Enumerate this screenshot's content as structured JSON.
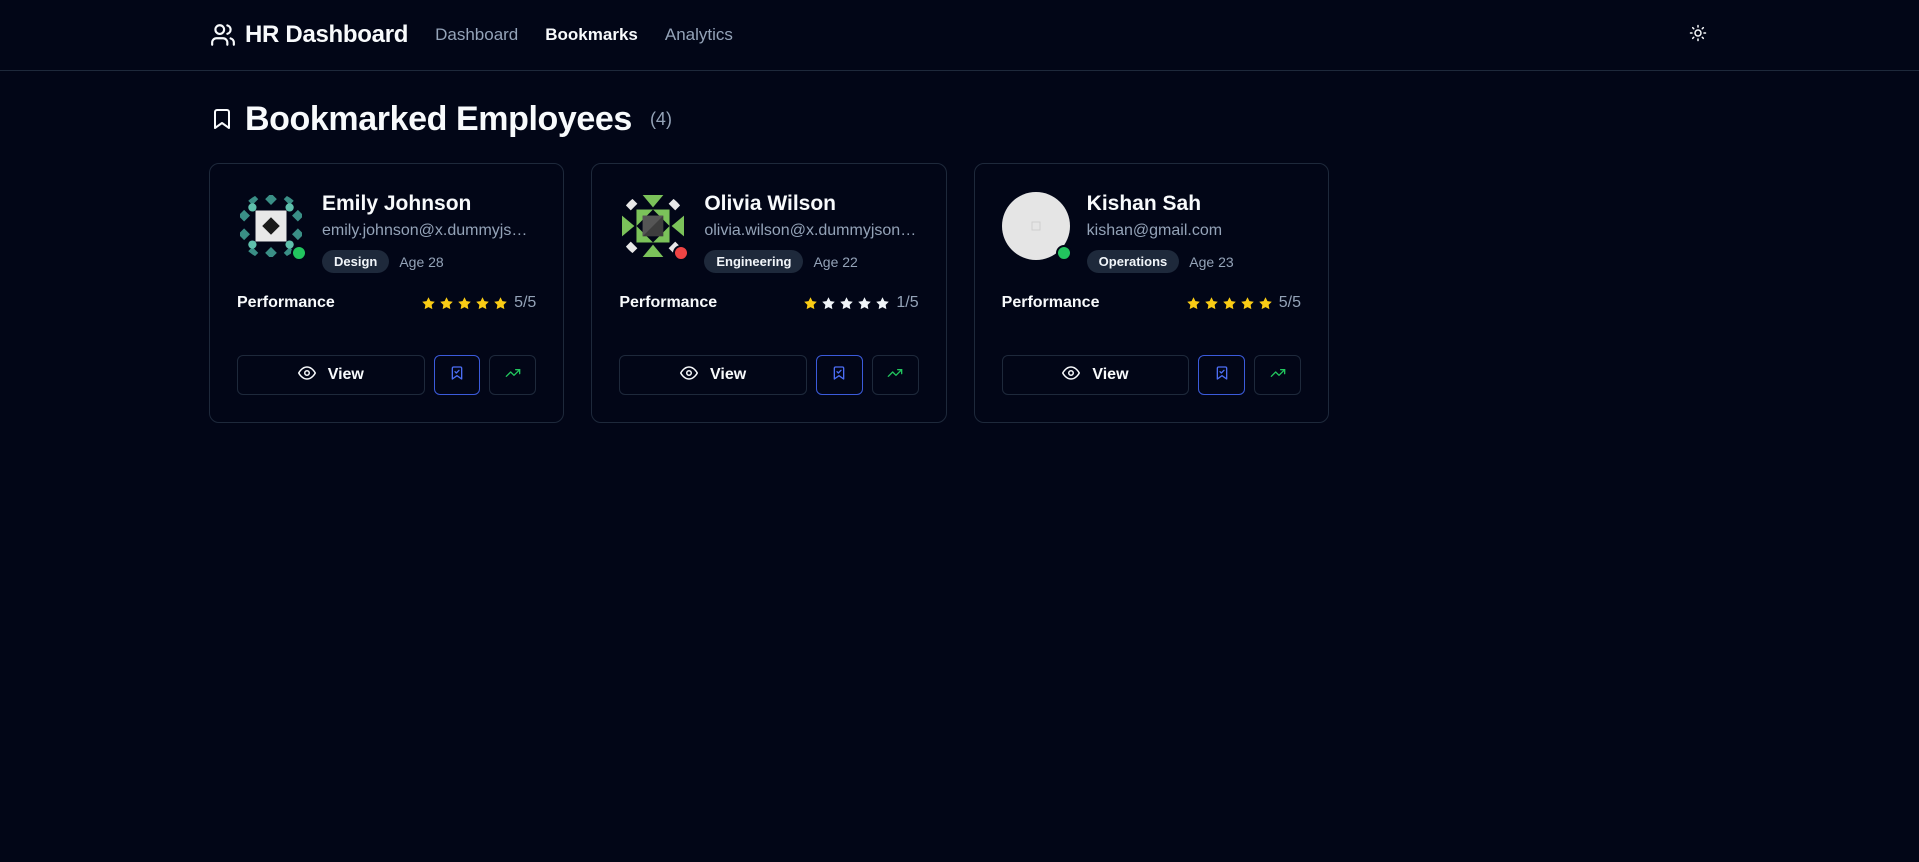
{
  "header": {
    "title": "HR Dashboard",
    "nav": [
      {
        "label": "Dashboard",
        "active": false
      },
      {
        "label": "Bookmarks",
        "active": true
      },
      {
        "label": "Analytics",
        "active": false
      }
    ]
  },
  "page": {
    "title": "Bookmarked Employees",
    "count": "(4)"
  },
  "labels": {
    "performance": "Performance",
    "view": "View"
  },
  "colors": {
    "star_filled": "#facc15",
    "star_empty": "#f1f5f9",
    "online": "#22c55e",
    "offline": "#ef4444",
    "bookmark_accent": "#3b5bdb",
    "trend": "#22c55e"
  },
  "employees": [
    {
      "name": "Emily Johnson",
      "email": "emily.johnson@x.dummyjson.com",
      "department": "Design",
      "age": "Age 28",
      "rating": 5,
      "rating_text": "5/5",
      "status": "online",
      "avatar": "identicon-teal"
    },
    {
      "name": "Olivia Wilson",
      "email": "olivia.wilson@x.dummyjson.com",
      "department": "Engineering",
      "age": "Age 22",
      "rating": 1,
      "rating_text": "1/5",
      "status": "offline",
      "avatar": "identicon-green"
    },
    {
      "name": "Kishan Sah",
      "email": "kishan@gmail.com",
      "department": "Operations",
      "age": "Age 23",
      "rating": 5,
      "rating_text": "5/5",
      "status": "online",
      "avatar": "placeholder"
    }
  ]
}
